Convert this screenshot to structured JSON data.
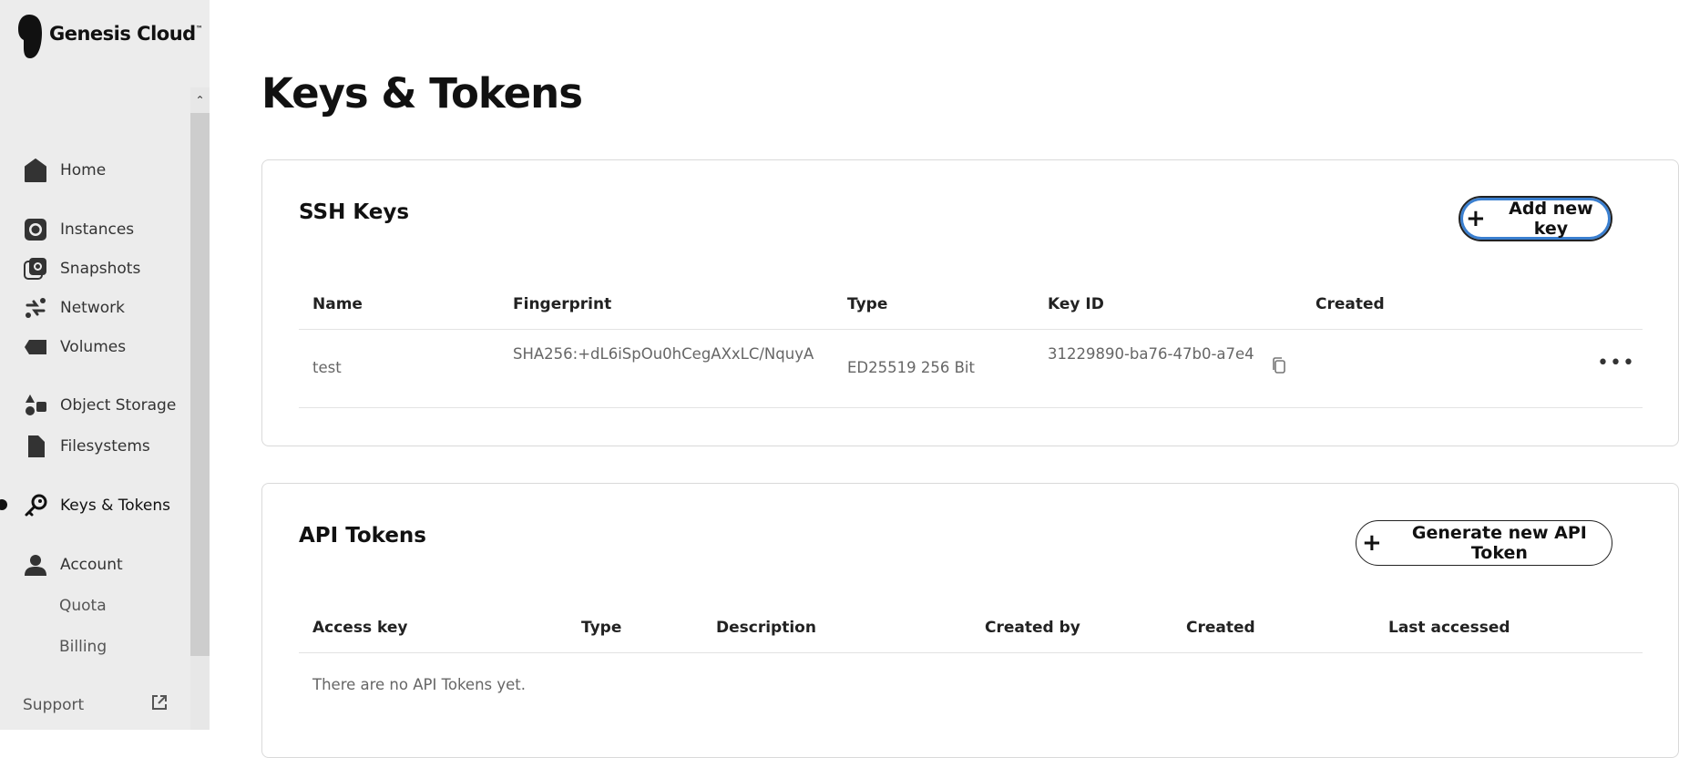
{
  "brand": {
    "name": "Genesis Cloud",
    "tm": "™"
  },
  "sidebar": {
    "items": [
      {
        "label": "Home",
        "icon": "home-icon"
      },
      {
        "label": "Instances",
        "icon": "instances-icon"
      },
      {
        "label": "Snapshots",
        "icon": "snapshots-icon"
      },
      {
        "label": "Network",
        "icon": "network-icon"
      },
      {
        "label": "Volumes",
        "icon": "volumes-icon"
      },
      {
        "label": "Object Storage",
        "icon": "object-storage-icon"
      },
      {
        "label": "Filesystems",
        "icon": "filesystems-icon"
      },
      {
        "label": "Keys & Tokens",
        "icon": "key-icon",
        "active": true
      },
      {
        "label": "Account",
        "icon": "user-icon"
      },
      {
        "label": "Quota",
        "icon": ""
      },
      {
        "label": "Billing",
        "icon": ""
      }
    ],
    "support": {
      "label": "Support",
      "icon": "external-link-icon"
    }
  },
  "page": {
    "title": "Keys & Tokens"
  },
  "ssh_keys": {
    "title": "SSH Keys",
    "add_button": "Add new key",
    "columns": [
      "Name",
      "Fingerprint",
      "Type",
      "Key ID",
      "Created"
    ],
    "rows": [
      {
        "name": "test",
        "fingerprint": "SHA256:+dL6iSpOu0hCegAXxLC/NquyA",
        "type": "ED25519 256 Bit",
        "key_id": "31229890-ba76-47b0-a7e4",
        "created": ""
      }
    ]
  },
  "api_tokens": {
    "title": "API Tokens",
    "generate_button": "Generate new API Token",
    "columns": [
      "Access key",
      "Type",
      "Description",
      "Created by",
      "Created",
      "Last accessed"
    ],
    "empty_text": "There are no API Tokens yet."
  },
  "colors": {
    "focus_ring": "#3a7fd0",
    "sidebar_bg": "#ececec",
    "text": "#111111"
  }
}
